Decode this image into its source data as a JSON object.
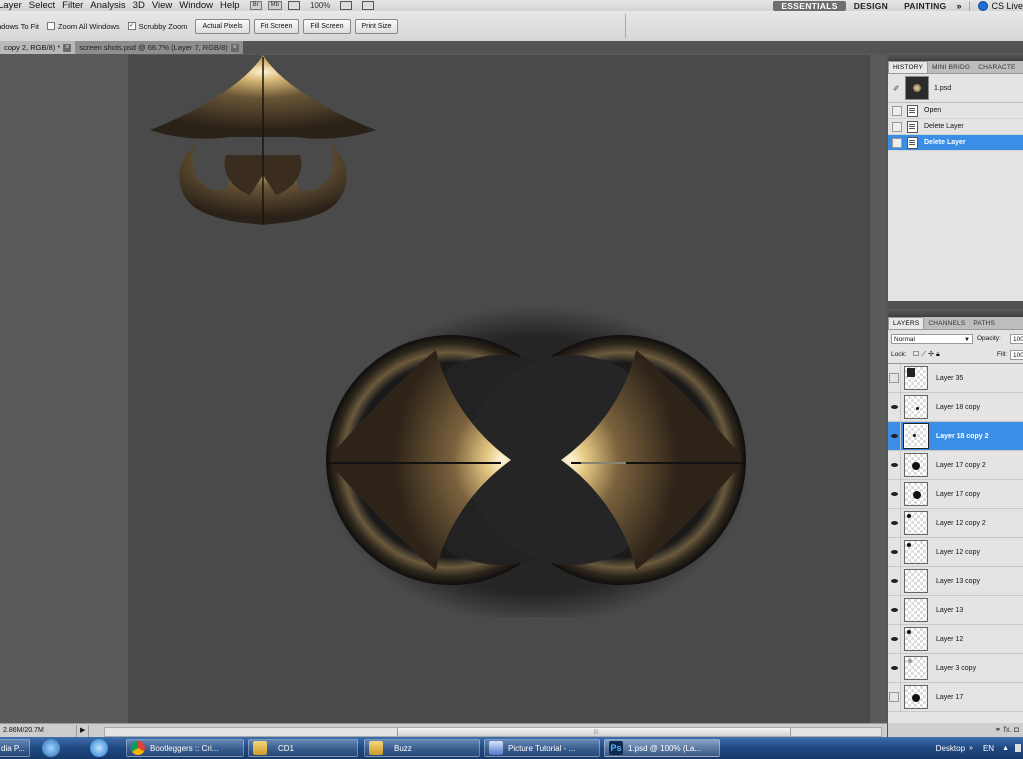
{
  "menu": {
    "items": [
      "Layer",
      "Select",
      "Filter",
      "Analysis",
      "3D",
      "View",
      "Window",
      "Help"
    ],
    "bridge_label": "Br",
    "minibridge_label": "Mb",
    "zoom": "100%",
    "workspaces": [
      "ESSENTIALS",
      "DESIGN",
      "PAINTING"
    ],
    "more": "»",
    "cslive": "CS Live"
  },
  "options": {
    "resize_windows": "ndows To Fit",
    "zoom_all": "Zoom All Windows",
    "scrubby_zoom": "Scrubby Zoom",
    "buttons": [
      "Actual Pixels",
      "Fit Screen",
      "Fill Screen",
      "Print Size"
    ]
  },
  "tabs": [
    {
      "label": "copy 2, RGB/8) *"
    },
    {
      "label": "screen shots.psd @ 66.7% (Layer 7, RGB/8)"
    }
  ],
  "status": {
    "doc_size": "2.86M/20.7M",
    "arrow": "▶"
  },
  "history": {
    "tabs": [
      "HISTORY",
      "MINI BRIDG",
      "CHARACTE"
    ],
    "snapshot": "1.psd",
    "states": [
      {
        "label": "Open",
        "active": false
      },
      {
        "label": "Delete Layer",
        "active": false
      },
      {
        "label": "Delete Layer",
        "active": true
      }
    ]
  },
  "layers": {
    "tabs": [
      "LAYERS",
      "CHANNELS",
      "PATHS"
    ],
    "blend_mode": "Normal",
    "opacity_label": "Opacity:",
    "opacity_value": "100",
    "lock_label": "Lock:",
    "fill_label": "Fill:",
    "fill_value": "100",
    "items": [
      {
        "name": "Layer 35",
        "visible": false,
        "active": false
      },
      {
        "name": "Layer 18 copy",
        "visible": true,
        "active": false
      },
      {
        "name": "Layer 18 copy 2",
        "visible": true,
        "active": true
      },
      {
        "name": "Layer 17 copy 2",
        "visible": true,
        "active": false
      },
      {
        "name": "Layer 17 copy",
        "visible": true,
        "active": false
      },
      {
        "name": "Layer 12 copy 2",
        "visible": true,
        "active": false
      },
      {
        "name": "Layer 12 copy",
        "visible": true,
        "active": false
      },
      {
        "name": "Layer 13 copy",
        "visible": true,
        "active": false
      },
      {
        "name": "Layer 13",
        "visible": true,
        "active": false
      },
      {
        "name": "Layer 12",
        "visible": true,
        "active": false
      },
      {
        "name": "Layer 3 copy",
        "visible": true,
        "active": false
      },
      {
        "name": "Layer 17",
        "visible": false,
        "active": false
      }
    ],
    "footer": "fx."
  },
  "taskbar": {
    "items": [
      {
        "label": "dia P..."
      },
      {
        "label": "Bootleggers :: Cri..."
      },
      {
        "label": "CD1"
      },
      {
        "label": "Buzz"
      },
      {
        "label": "Picture Tutorial - ..."
      },
      {
        "label": "1.psd @ 100% (La..."
      }
    ],
    "ps_icon_text": "Ps",
    "desktop": "Desktop",
    "lang": "EN"
  },
  "colors": {
    "selection": "#3a8ee6",
    "canvas_bg": "#4a4a4a",
    "workspace_bg": "#595959"
  }
}
